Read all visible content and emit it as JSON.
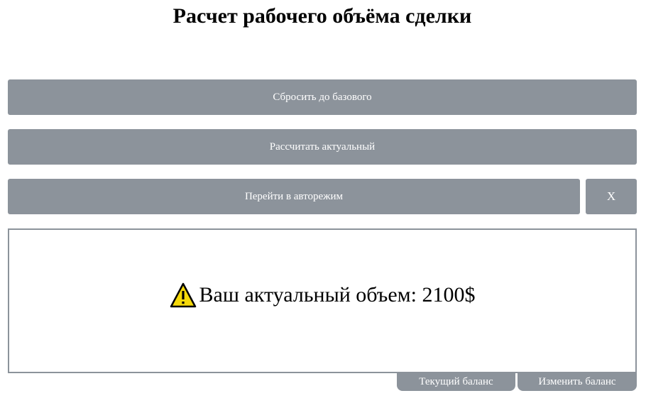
{
  "page": {
    "title": "Расчет рабочего объёма сделки"
  },
  "buttons": {
    "reset_label": "Сбросить до базового",
    "calculate_label": "Рассчитать актуальный",
    "auto_mode_label": "Перейти в авторежим",
    "close_label": "X"
  },
  "result": {
    "icon": "warning-icon",
    "text": "Ваш актуальный объем: 2100$"
  },
  "tabs": {
    "current_balance_label": "Текущий баланс",
    "change_balance_label": "Изменить баланс"
  },
  "colors": {
    "button_bg": "#8c939b",
    "warning_fill": "#f5d90a"
  }
}
